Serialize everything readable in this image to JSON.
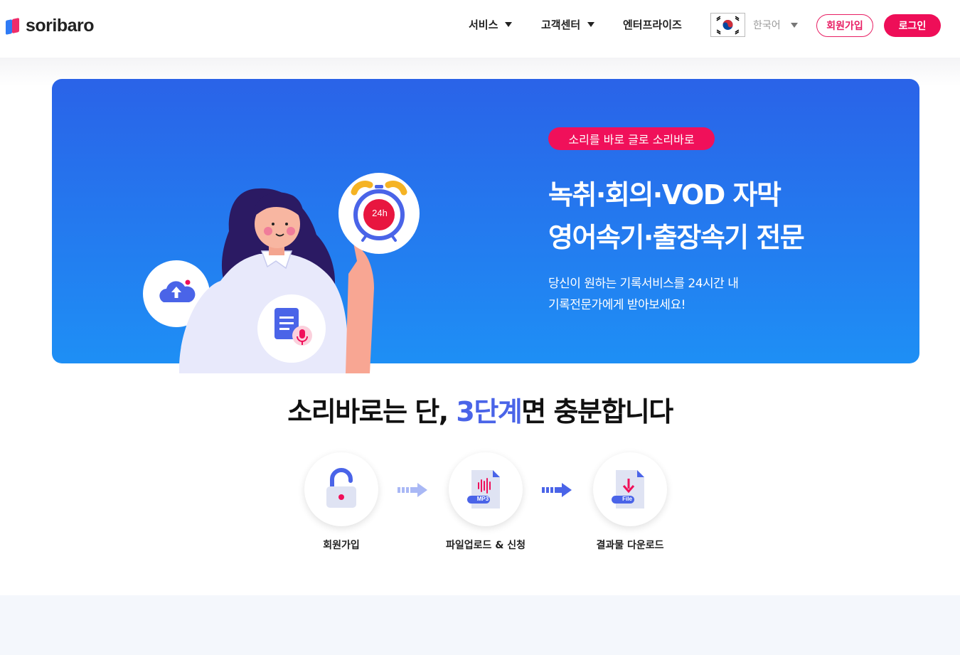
{
  "header": {
    "logo_text": "soribaro",
    "nav": {
      "service": "서비스",
      "support": "고객센터",
      "enterprise": "엔터프라이즈"
    },
    "language": "한국어",
    "join_label": "회원가입",
    "login_label": "로그인"
  },
  "hero": {
    "tag": "소리를 바로 글로 소리바로",
    "title_line1": "녹취·회의·VOD 자막",
    "title_line2": "영어속기·출장속기 전문",
    "desc_line1": "당신이 원하는 기록서비스를 24시간 내",
    "desc_line2": "기록전문가에게 받아보세요!",
    "clock_label": "24h"
  },
  "steps": {
    "title_prefix": "소리바로는 단, ",
    "title_accent": "3단계",
    "title_suffix": "면 충분합니다",
    "items": [
      {
        "label": "회원가입",
        "icon": "unlock-icon"
      },
      {
        "label": "파일업로드 & 신청",
        "icon": "mp3-file-icon",
        "badge": "MP3"
      },
      {
        "label": "결과물 다운로드",
        "icon": "file-download-icon",
        "badge": "File"
      }
    ]
  },
  "colors": {
    "brand_pink": "#ee0e58",
    "hero_blue_top": "#2a63e8",
    "hero_blue_bottom": "#1e8ff5",
    "accent_blue": "#4a64e8"
  }
}
